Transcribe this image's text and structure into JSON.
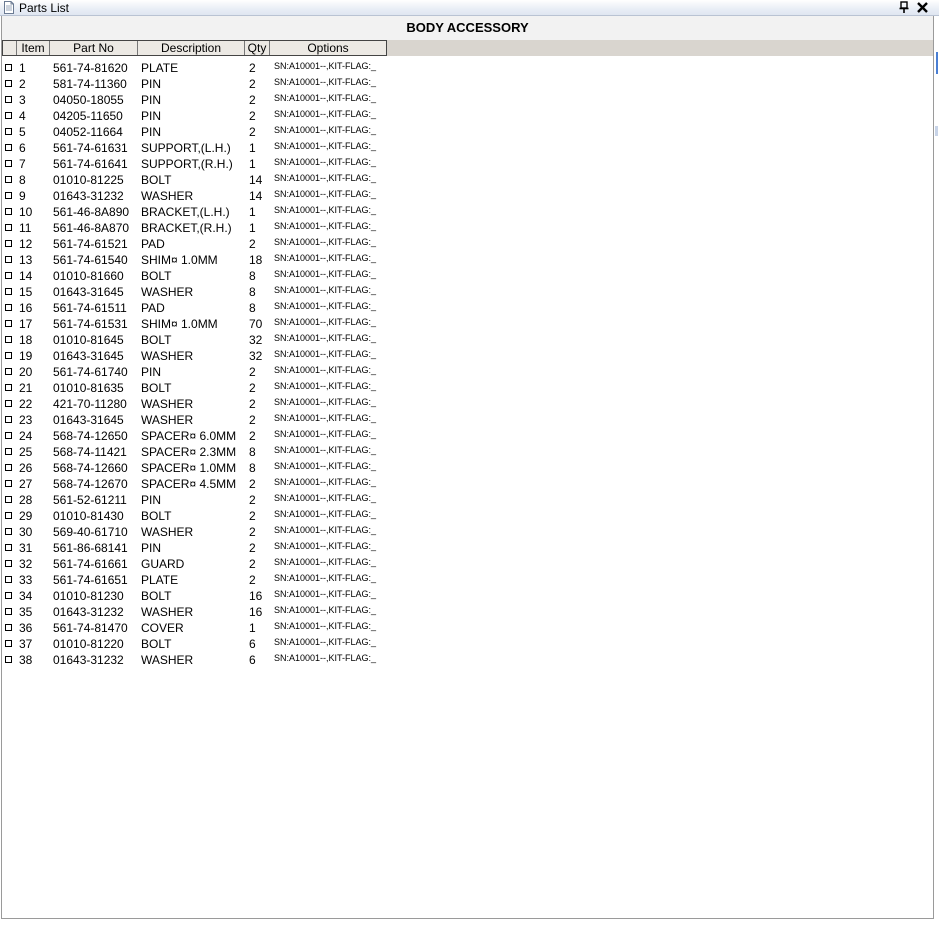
{
  "window": {
    "title": "Parts List",
    "icons": {
      "doc": "document-icon",
      "pin": "pin-icon",
      "close": "close-icon"
    }
  },
  "section": {
    "title": "BODY ACCESSORY"
  },
  "table": {
    "columns": [
      "Item",
      "Part No",
      "Description",
      "Qty",
      "Options"
    ],
    "rows": [
      {
        "item": "1",
        "part": "561-74-81620",
        "desc": "PLATE",
        "qty": "2",
        "opt": "SN:A10001--,KIT-FLAG:_"
      },
      {
        "item": "2",
        "part": "581-74-11360",
        "desc": "PIN",
        "qty": "2",
        "opt": "SN:A10001--,KIT-FLAG:_"
      },
      {
        "item": "3",
        "part": "04050-18055",
        "desc": "PIN",
        "qty": "2",
        "opt": "SN:A10001--,KIT-FLAG:_"
      },
      {
        "item": "4",
        "part": "04205-11650",
        "desc": "PIN",
        "qty": "2",
        "opt": "SN:A10001--,KIT-FLAG:_"
      },
      {
        "item": "5",
        "part": "04052-11664",
        "desc": "PIN",
        "qty": "2",
        "opt": "SN:A10001--,KIT-FLAG:_"
      },
      {
        "item": "6",
        "part": "561-74-61631",
        "desc": "SUPPORT,(L.H.)",
        "qty": "1",
        "opt": "SN:A10001--,KIT-FLAG:_"
      },
      {
        "item": "7",
        "part": "561-74-61641",
        "desc": "SUPPORT,(R.H.)",
        "qty": "1",
        "opt": "SN:A10001--,KIT-FLAG:_"
      },
      {
        "item": "8",
        "part": "01010-81225",
        "desc": "BOLT",
        "qty": "14",
        "opt": "SN:A10001--,KIT-FLAG:_"
      },
      {
        "item": "9",
        "part": "01643-31232",
        "desc": "WASHER",
        "qty": "14",
        "opt": "SN:A10001--,KIT-FLAG:_"
      },
      {
        "item": "10",
        "part": "561-46-8A890",
        "desc": "BRACKET,(L.H.)",
        "qty": "1",
        "opt": "SN:A10001--,KIT-FLAG:_"
      },
      {
        "item": "11",
        "part": "561-46-8A870",
        "desc": "BRACKET,(R.H.)",
        "qty": "1",
        "opt": "SN:A10001--,KIT-FLAG:_"
      },
      {
        "item": "12",
        "part": "561-74-61521",
        "desc": "PAD",
        "qty": "2",
        "opt": "SN:A10001--,KIT-FLAG:_"
      },
      {
        "item": "13",
        "part": "561-74-61540",
        "desc": "SHIM¤ 1.0MM",
        "qty": "18",
        "opt": "SN:A10001--,KIT-FLAG:_"
      },
      {
        "item": "14",
        "part": "01010-81660",
        "desc": "BOLT",
        "qty": "8",
        "opt": "SN:A10001--,KIT-FLAG:_"
      },
      {
        "item": "15",
        "part": "01643-31645",
        "desc": "WASHER",
        "qty": "8",
        "opt": "SN:A10001--,KIT-FLAG:_"
      },
      {
        "item": "16",
        "part": "561-74-61511",
        "desc": "PAD",
        "qty": "8",
        "opt": "SN:A10001--,KIT-FLAG:_"
      },
      {
        "item": "17",
        "part": "561-74-61531",
        "desc": "SHIM¤ 1.0MM",
        "qty": "70",
        "opt": "SN:A10001--,KIT-FLAG:_"
      },
      {
        "item": "18",
        "part": "01010-81645",
        "desc": "BOLT",
        "qty": "32",
        "opt": "SN:A10001--,KIT-FLAG:_"
      },
      {
        "item": "19",
        "part": "01643-31645",
        "desc": "WASHER",
        "qty": "32",
        "opt": "SN:A10001--,KIT-FLAG:_"
      },
      {
        "item": "20",
        "part": "561-74-61740",
        "desc": "PIN",
        "qty": "2",
        "opt": "SN:A10001--,KIT-FLAG:_"
      },
      {
        "item": "21",
        "part": "01010-81635",
        "desc": "BOLT",
        "qty": "2",
        "opt": "SN:A10001--,KIT-FLAG:_"
      },
      {
        "item": "22",
        "part": "421-70-11280",
        "desc": "WASHER",
        "qty": "2",
        "opt": "SN:A10001--,KIT-FLAG:_"
      },
      {
        "item": "23",
        "part": "01643-31645",
        "desc": "WASHER",
        "qty": "2",
        "opt": "SN:A10001--,KIT-FLAG:_"
      },
      {
        "item": "24",
        "part": "568-74-12650",
        "desc": "SPACER¤ 6.0MM",
        "qty": "2",
        "opt": "SN:A10001--,KIT-FLAG:_"
      },
      {
        "item": "25",
        "part": "568-74-11421",
        "desc": "SPACER¤ 2.3MM",
        "qty": "8",
        "opt": "SN:A10001--,KIT-FLAG:_"
      },
      {
        "item": "26",
        "part": "568-74-12660",
        "desc": "SPACER¤ 1.0MM",
        "qty": "8",
        "opt": "SN:A10001--,KIT-FLAG:_"
      },
      {
        "item": "27",
        "part": "568-74-12670",
        "desc": "SPACER¤ 4.5MM",
        "qty": "2",
        "opt": "SN:A10001--,KIT-FLAG:_"
      },
      {
        "item": "28",
        "part": "561-52-61211",
        "desc": "PIN",
        "qty": "2",
        "opt": "SN:A10001--,KIT-FLAG:_"
      },
      {
        "item": "29",
        "part": "01010-81430",
        "desc": "BOLT",
        "qty": "2",
        "opt": "SN:A10001--,KIT-FLAG:_"
      },
      {
        "item": "30",
        "part": "569-40-61710",
        "desc": "WASHER",
        "qty": "2",
        "opt": "SN:A10001--,KIT-FLAG:_"
      },
      {
        "item": "31",
        "part": "561-86-68141",
        "desc": "PIN",
        "qty": "2",
        "opt": "SN:A10001--,KIT-FLAG:_"
      },
      {
        "item": "32",
        "part": "561-74-61661",
        "desc": "GUARD",
        "qty": "2",
        "opt": "SN:A10001--,KIT-FLAG:_"
      },
      {
        "item": "33",
        "part": "561-74-61651",
        "desc": "PLATE",
        "qty": "2",
        "opt": "SN:A10001--,KIT-FLAG:_"
      },
      {
        "item": "34",
        "part": "01010-81230",
        "desc": "BOLT",
        "qty": "16",
        "opt": "SN:A10001--,KIT-FLAG:_"
      },
      {
        "item": "35",
        "part": "01643-31232",
        "desc": "WASHER",
        "qty": "16",
        "opt": "SN:A10001--,KIT-FLAG:_"
      },
      {
        "item": "36",
        "part": "561-74-81470",
        "desc": "COVER",
        "qty": "1",
        "opt": "SN:A10001--,KIT-FLAG:_"
      },
      {
        "item": "37",
        "part": "01010-81220",
        "desc": "BOLT",
        "qty": "6",
        "opt": "SN:A10001--,KIT-FLAG:_"
      },
      {
        "item": "38",
        "part": "01643-31232",
        "desc": "WASHER",
        "qty": "6",
        "opt": "SN:A10001--,KIT-FLAG:_"
      }
    ]
  }
}
